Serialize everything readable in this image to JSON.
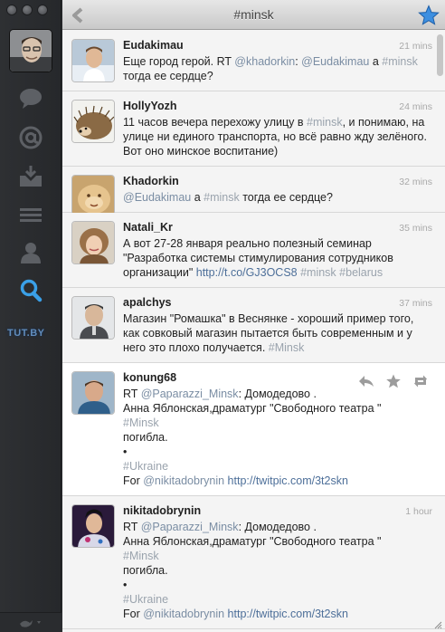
{
  "header": {
    "title": "#minsk"
  },
  "sidebar": {
    "items": [
      {
        "icon": "speech-bubble-icon",
        "label": "Timeline"
      },
      {
        "icon": "at-sign-icon",
        "label": "Mentions"
      },
      {
        "icon": "inbox-icon",
        "label": "Messages"
      },
      {
        "icon": "list-icon",
        "label": "Lists"
      },
      {
        "icon": "person-icon",
        "label": "Profile"
      },
      {
        "icon": "search-icon",
        "label": "Search"
      }
    ],
    "watermark": "TUT.BY"
  },
  "tweets": [
    {
      "user": "Eudakimau",
      "time": "21 mins",
      "lines": [
        "Еще город герой. RT ",
        "@khadorkin",
        ": ",
        "@Eudakimau",
        " а ",
        "#minsk",
        " тогда ее сердце?"
      ]
    },
    {
      "user": "HollyYozh",
      "time": "24 mins",
      "lines": [
        "11 часов вечера перехожу улицу в ",
        "#minsk",
        ", и понимаю, на улице ни единого транспорта, но всё равно жду зелёного. Вот оно минское воспитание)"
      ]
    },
    {
      "user": "Khadorkin",
      "time": "32 mins",
      "lines": [
        "@Eudakimau",
        " а ",
        "#minsk",
        " тогда ее сердце?"
      ]
    },
    {
      "user": "Natali_Kr",
      "time": "35 mins",
      "lines": [
        "А вот 27-28 января реально полезный семинар \"Разработка системы стимулирования сотрудников организации\" ",
        "http://t.co/GJ3OCS8",
        " ",
        "#minsk",
        " ",
        "#belarus"
      ]
    },
    {
      "user": "apalchys",
      "time": "37 mins",
      "lines": [
        "Магазин \"Ромашка\" в Веснянке - хороший пример того, как совковый магазин пытается быть современным и у него это плохо получается. ",
        "#Minsk"
      ]
    },
    {
      "user": "konung68",
      "time": "",
      "lines": [
        "RT ",
        "@Paparazzi_Minsk",
        ": Домодедово .",
        "Анна Яблонская,драматург \"Свободного театра \"",
        "#Minsk",
        "погибла.",
        "•",
        "#Ukraine",
        "For ",
        "@nikitadobrynin",
        " ",
        "http://twitpic.com/3t2skn"
      ]
    },
    {
      "user": "nikitadobrynin",
      "time": "1 hour",
      "lines": [
        "RT ",
        "@Paparazzi_Minsk",
        ": Домодедово .",
        "Анна Яблонская,драматург \"Свободного театра \"",
        "#Minsk",
        "погибла.",
        "•",
        "#Ukraine",
        "For ",
        "@nikitadobrynin",
        " ",
        "http://twitpic.com/3t2skn"
      ]
    }
  ],
  "colors": {
    "mention": "#7a8da3",
    "hashtag": "#9aa3ad",
    "link": "#4d6f99",
    "search_active": "#3aa0e8"
  }
}
